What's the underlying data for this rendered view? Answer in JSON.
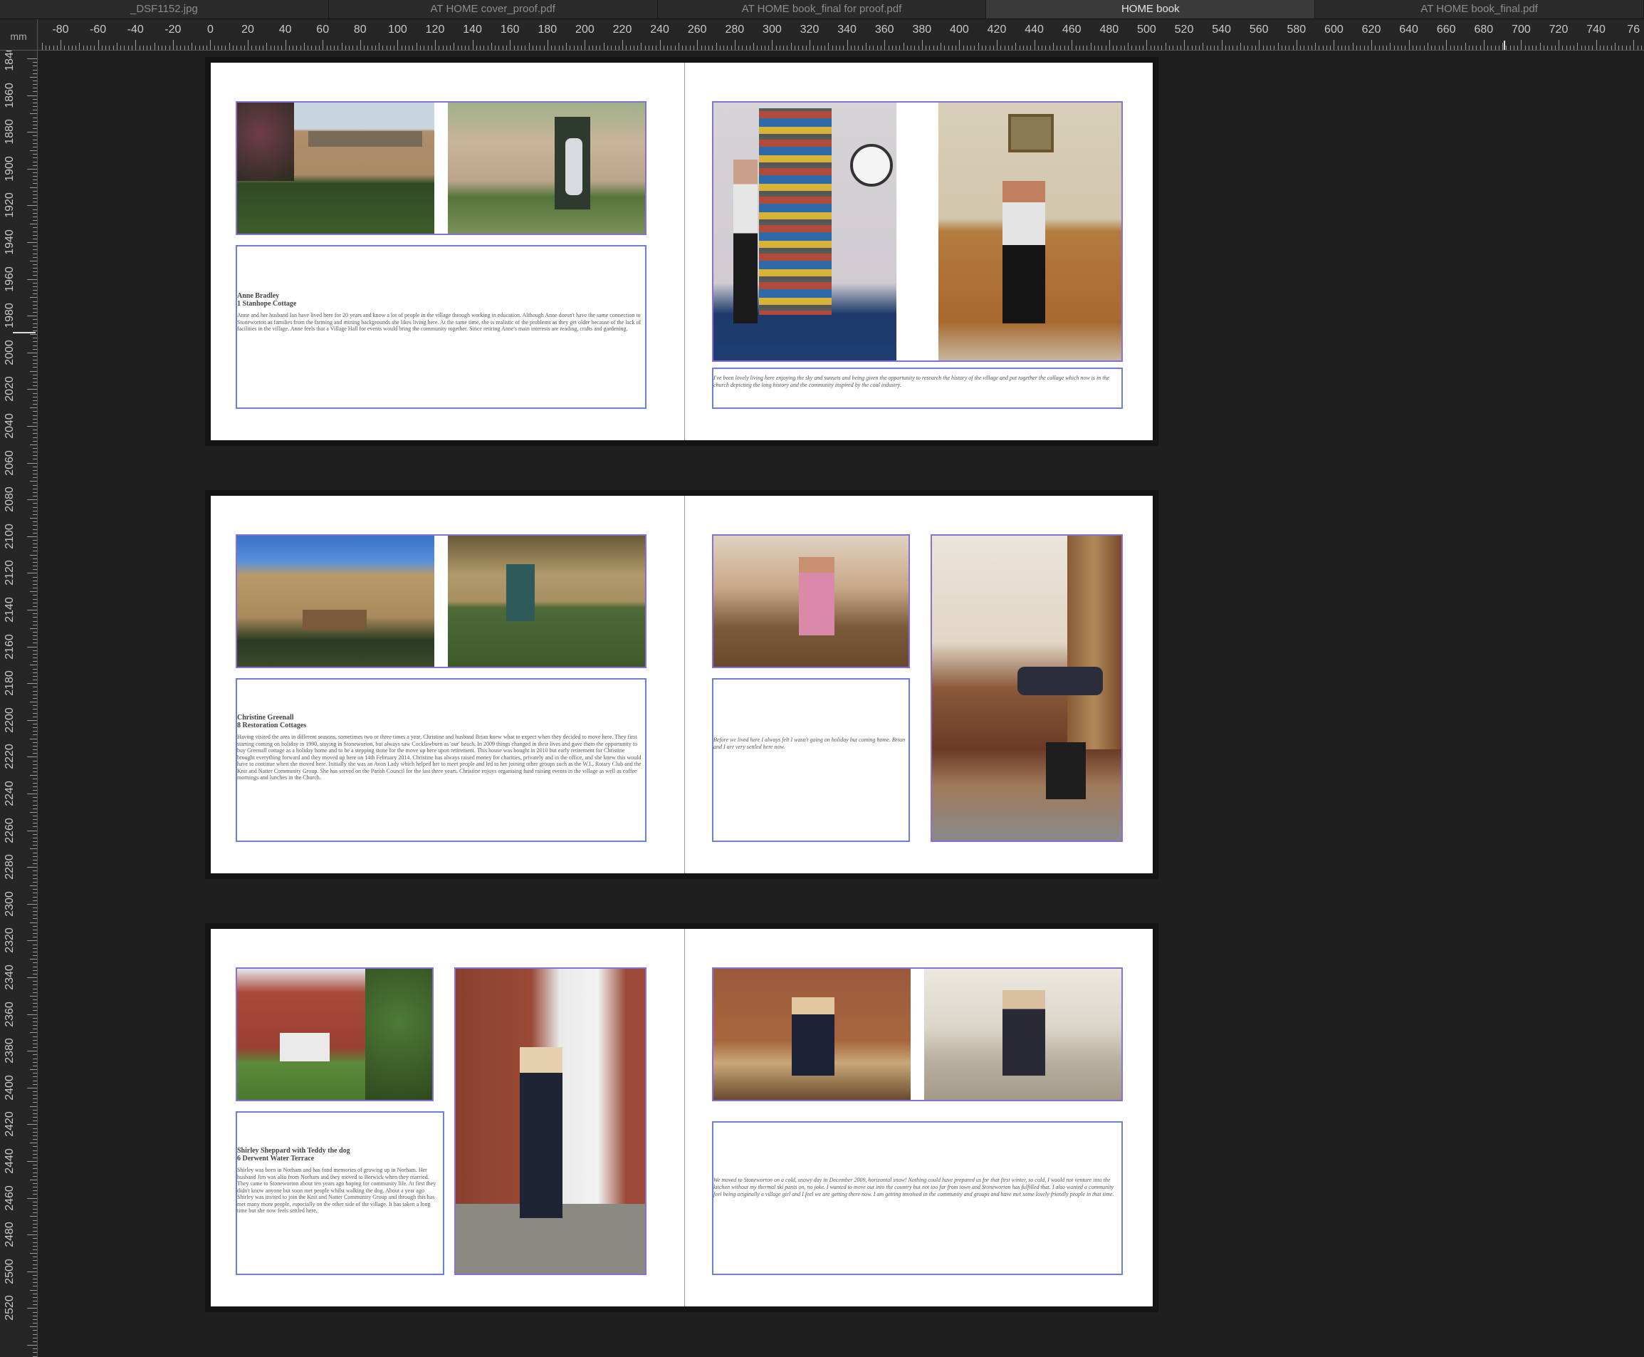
{
  "tabs": [
    {
      "label": "_DSF1152.jpg",
      "active": false
    },
    {
      "label": "AT HOME cover_proof.pdf",
      "active": false
    },
    {
      "label": "AT HOME book_final for proof.pdf",
      "active": false
    },
    {
      "label": "HOME book",
      "active": true
    },
    {
      "label": "AT HOME book_final.pdf",
      "active": false
    }
  ],
  "ruler": {
    "unit": "mm",
    "h_labels": [
      "-80",
      "-60",
      "-40",
      "-20",
      "0",
      "20",
      "40",
      "60",
      "80",
      "100",
      "120",
      "140",
      "160",
      "180",
      "200",
      "220",
      "240",
      "260",
      "280",
      "300",
      "320",
      "340",
      "360",
      "380",
      "400",
      "420",
      "440",
      "460",
      "480",
      "500",
      "520",
      "540",
      "560",
      "580",
      "600",
      "620",
      "640",
      "660",
      "680",
      "700",
      "720",
      "740",
      "76"
    ],
    "v_labels": [
      "1840",
      "1860",
      "1880",
      "1900",
      "1920",
      "1940",
      "1960",
      "1980",
      "2000",
      "2020",
      "2040",
      "2060",
      "2080",
      "2100",
      "2120",
      "2140",
      "2160",
      "2180",
      "2200",
      "2220",
      "2240",
      "2260",
      "2280",
      "2300",
      "2320",
      "2340",
      "2360",
      "2380",
      "2400",
      "2420",
      "2440",
      "2460",
      "2480",
      "2500",
      "2520"
    ]
  },
  "spreads": [
    {
      "left_text": {
        "name": "Anne Bradley",
        "address": "1 Stanhope Cottage",
        "body": "Anne and her husband Ian have lived here for 20 years and know a lot of people in the village through working in education. Although Anne doesn't have the same connection to Stoneworton as families from the farming and mining backgrounds she likes living here. At the same time, she is realistic of the problems as they get older because of the lack of facilities in the village. Anne feels that a Village Hall for events would bring the community together. Since retiring Anne's main interests are reading, crafts and gardening."
      },
      "right_text": {
        "quote": "I've been lovely living here enjoying the sky and sunsets and being given the opportunity to research the history of the village and put together the collage which now is in the church depicting the long history and the community inspired by the coal industry."
      }
    },
    {
      "left_text": {
        "name": "Christine Greenall",
        "address": "8 Restoration Cottages",
        "body": "Having visited the area in different seasons, sometimes two or three times a year, Christine and husband Brian knew what to expect when they decided to move here. They first starting coming on holiday in 1990, staying in Stoneworton, but always saw Cocklawburn as 'our' beach. In 2009 things changed in their lives and gave them the opportunity to buy Greenall cottage as a holiday home and to be a stepping stone for the move up here upon retirement. This house was bought in 2010 but early retirement for Christine brought everything forward and they moved up here on 14th February 2014. Christine has always raised money for charities, privately and in the office, and she knew this would have to continue when she moved here. Initially she was an Avon Lady which helped her to meet people and led to her joining other groups such as the W.I., Rotary Club and the Knit and Natter Community Group. She has served on the Parish Council for the last three years. Christine enjoys organising fund raising events in the village as well as coffee mornings and lunches in the Church."
      },
      "right_text": {
        "quote": "Before we lived here I always felt I wasn't going on holiday but coming home. Brian and I are very settled here now."
      }
    },
    {
      "left_text": {
        "name": "Shirley Sheppard with Teddy the dog",
        "address": "6 Derwent Water Terrace",
        "body": "Shirley was born in Norham and has fond memories of growing up in Norham. Her husband Jim was also from Norham and they moved to Berwick when they married. They came to Stoneworton about ten years ago hoping for community life. At first they didn't know anyone but soon met people whilst walking the dog. About a year ago Shirley was invited to join the Knit and Natter Community Group and through this has met many more people, especially on the other side of the village. It has taken a long time but she now feels settled here."
      },
      "right_text": {
        "quote": "We moved to Stoneworton on a cold, snowy day in December 2009, horizontal snow! Nothing could have prepared us for that first winter, so cold, I would not venture into the kitchen without my thermal ski pants on, no joke. I wanted to move out into the country but not too far from town and Stoneworton has fulfilled that. I also wanted a community feel being originally a village girl and I feel we are getting there now. I am getting involved in the community and groups and have met some lovely friendly people in that time."
      }
    }
  ]
}
